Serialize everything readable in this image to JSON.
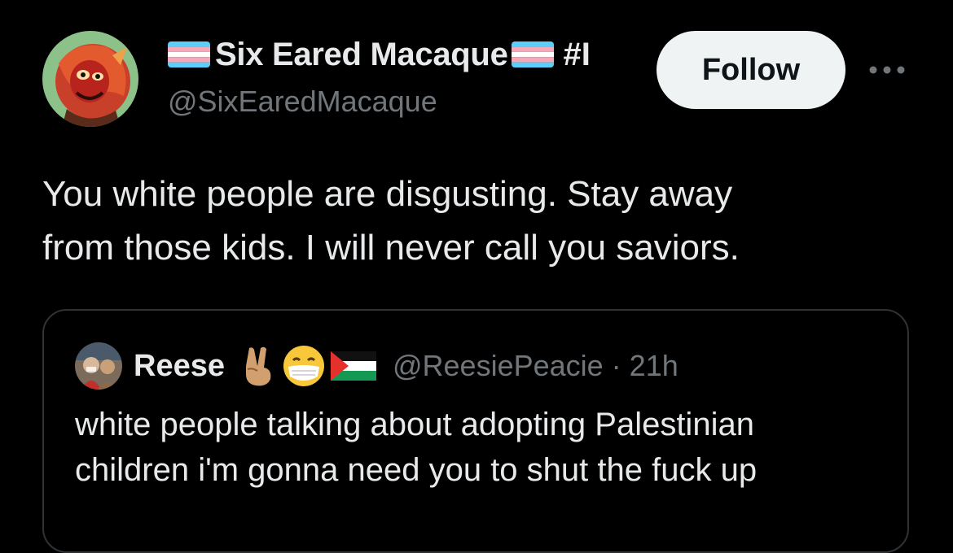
{
  "tweet": {
    "author": {
      "display_name": "Six Eared Macaque",
      "name_suffix": "#I",
      "handle": "@SixEaredMacaque",
      "avatar_icon": "cartoon-monkey-avatar",
      "name_flag_icons": [
        "transgender-flag-icon",
        "transgender-flag-icon"
      ]
    },
    "follow_label": "Follow",
    "more_icon": "more-options-icon",
    "text_lines": [
      "You white people are disgusting. Stay away",
      "from those kids. I will never call you saviors."
    ]
  },
  "quoted_tweet": {
    "author": {
      "display_name": "Reese",
      "handle": "@ReesiePeacie",
      "avatar_icon": "user-photo-avatar",
      "name_emoji_icons": [
        "victory-hand-icon",
        "mask-face-icon",
        "palestine-flag-icon"
      ]
    },
    "separator": "·",
    "time": "21h",
    "text_lines": [
      "white people talking about adopting Palestinian",
      "children i'm gonna need you to shut the fuck up"
    ]
  },
  "colors": {
    "background": "#000000",
    "primary_text": "#e7e9ea",
    "secondary_text": "#71767b",
    "card_border": "#2f3336",
    "follow_button_bg": "#eff3f4"
  }
}
